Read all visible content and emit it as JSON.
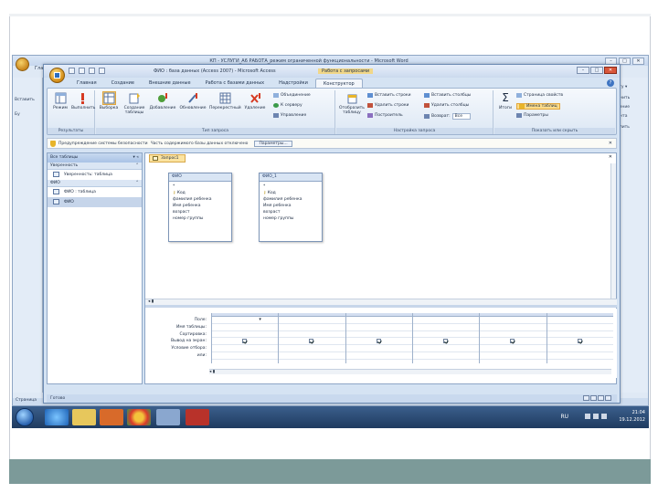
{
  "background_window": {
    "title": "КП - УСЛУГИ_А6 РАБОТА_режим ограниченной функциональности - Microsoft Word",
    "left_labels": [
      "Вставить",
      "Бу"
    ],
    "right_labels": [
      "лгту ▾",
      "менить",
      "еление",
      "мента",
      "делить"
    ],
    "status": "Страница",
    "tab_label": "Главная"
  },
  "access": {
    "title": "ФИО : база данных (Access 2007) - Microsoft Access",
    "context_title": "Работа с запросами",
    "tabs": [
      "Главная",
      "Создание",
      "Внешние данные",
      "Работа с базами данных",
      "Надстройки",
      "Конструктор"
    ],
    "active_tab_index": 5,
    "ribbon": {
      "groups": [
        {
          "name": "Результаты",
          "buttons": [
            "Режим",
            "Выполнить"
          ]
        },
        {
          "name": "Тип запроса",
          "buttons": [
            "Выборка",
            "Создание таблицы",
            "Добавление",
            "Обновление",
            "Перекрестный",
            "Удаление"
          ],
          "small": [
            "Объединение",
            "К серверу",
            "Управление"
          ]
        },
        {
          "name": "Настройка запроса",
          "big": [
            "Отобразить таблицу"
          ],
          "small": [
            "Вставить строки",
            "Удалить строки",
            "Построитель",
            "Вставить столбцы",
            "Удалить столбцы",
            "Возврат:"
          ],
          "return_value": "Все"
        },
        {
          "name": "Показать или скрыть",
          "big": [
            "Итоги"
          ],
          "small": [
            "Страница свойств",
            "Имена таблиц",
            "Параметры"
          ]
        }
      ]
    },
    "security_bar": {
      "title": "Предупреждение системы безопасности",
      "message": "Часть содержимого базы данных отключено",
      "button": "Параметры..."
    },
    "nav": {
      "header": "Все таблицы",
      "sections": [
        {
          "title": "Уверенность",
          "items": [
            "Уверенность: таблица"
          ]
        },
        {
          "title": "ФИО",
          "items": [
            "ФИО : таблица",
            "ФИО"
          ]
        }
      ],
      "selected": "ФИО"
    },
    "query_tab": "Запрос1",
    "tables": [
      {
        "name": "ФИО",
        "fields": [
          "*",
          "Код",
          "фамилия ребенка",
          "Имя ребенка",
          "возраст",
          "номер группы"
        ]
      },
      {
        "name": "ФИО_1",
        "fields": [
          "*",
          "Код",
          "фамилия ребенка",
          "Имя ребенка",
          "возраст",
          "номер группы"
        ]
      }
    ],
    "grid": {
      "row_labels": [
        "Поле:",
        "Имя таблицы:",
        "Сортировка:",
        "Вывод на экран:",
        "Условие отбора:",
        "или:"
      ],
      "columns": 6,
      "checked": [
        true,
        true,
        true,
        true,
        true,
        true
      ]
    },
    "status": "Готово"
  },
  "taskbar": {
    "language": "RU",
    "time": "21:04",
    "date": "19.12.2012"
  }
}
